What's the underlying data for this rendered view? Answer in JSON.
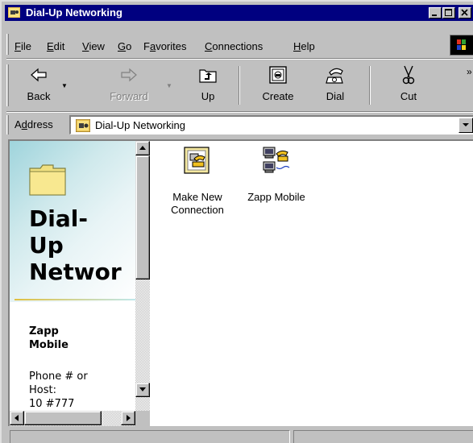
{
  "window": {
    "title": "Dial-Up Networking"
  },
  "menubar": {
    "items": [
      {
        "label": "File",
        "u": "F",
        "rest": "ile"
      },
      {
        "label": "Edit",
        "u": "E",
        "rest": "dit"
      },
      {
        "label": "View",
        "u": "V",
        "rest": "iew"
      },
      {
        "label": "Go",
        "u": "G",
        "rest": "o"
      },
      {
        "label": "Favorites",
        "pre": "F",
        "u": "a",
        "rest": "vorites"
      },
      {
        "label": "Connections",
        "u": "C",
        "rest": "onnections"
      },
      {
        "label": "Help",
        "u": "H",
        "rest": "elp"
      }
    ]
  },
  "toolbar": {
    "back": "Back",
    "forward": "Forward",
    "up": "Up",
    "create": "Create",
    "dial": "Dial",
    "cut": "Cut",
    "overflow": "»"
  },
  "address": {
    "label_pre": "A",
    "label_u": "d",
    "label_rest": "dress",
    "value": "Dial-Up Networking"
  },
  "webview": {
    "title_lines": [
      "Dial-",
      "Up",
      "Networ"
    ],
    "selected_name_lines": [
      "Zapp",
      "Mobile"
    ],
    "info_lines": [
      "Phone # or",
      "Host:",
      "10 #777"
    ]
  },
  "files": [
    {
      "name": "Make New\nConnection",
      "icon": "make-new-connection-icon"
    },
    {
      "name": "Zapp Mobile",
      "icon": "dialup-connection-icon"
    }
  ],
  "status": {
    "left": "",
    "right": ""
  }
}
